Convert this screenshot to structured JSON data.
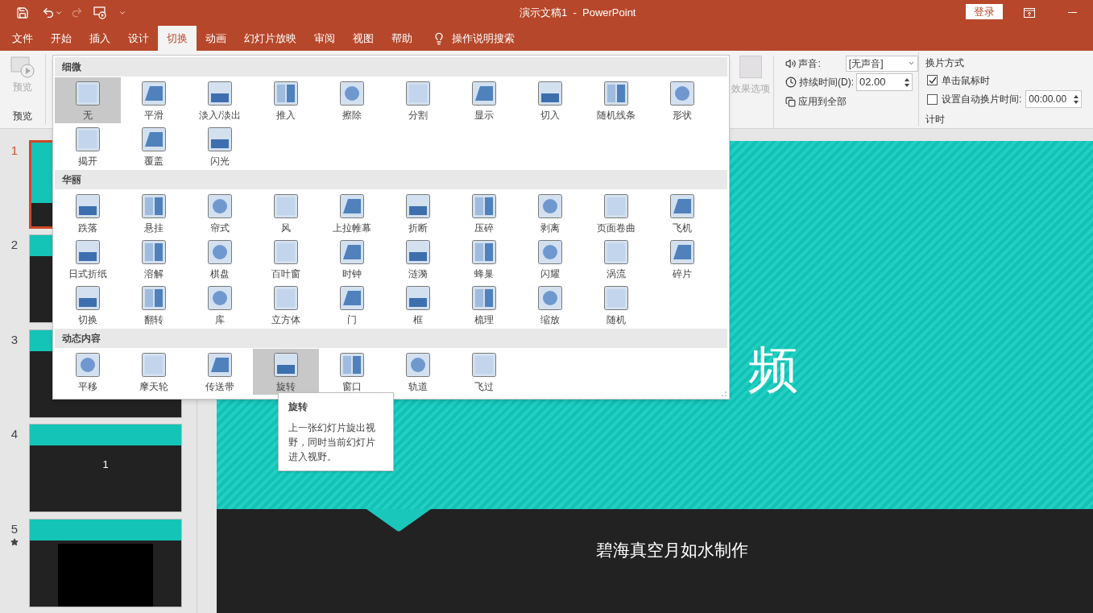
{
  "window": {
    "title": "演示文稿1  -  PowerPoint",
    "sign_in": "登录"
  },
  "tabs": [
    {
      "label": "文件",
      "selected": false
    },
    {
      "label": "开始",
      "selected": false
    },
    {
      "label": "插入",
      "selected": false
    },
    {
      "label": "设计",
      "selected": false
    },
    {
      "label": "切换",
      "selected": true
    },
    {
      "label": "动画",
      "selected": false
    },
    {
      "label": "幻灯片放映",
      "selected": false
    },
    {
      "label": "审阅",
      "selected": false
    },
    {
      "label": "视图",
      "selected": false
    },
    {
      "label": "帮助",
      "selected": false
    }
  ],
  "tell_me": "操作说明搜索",
  "preview": {
    "button": "预览",
    "group": "预览"
  },
  "effect_options": "效果选项",
  "timing": {
    "sound_label": "声音:",
    "sound_value": "[无声音]",
    "duration_label": "持续时间(D):",
    "duration_value": "02.00",
    "apply_all": "应用到全部",
    "advance_header": "换片方式",
    "on_click": {
      "label": "单击鼠标时",
      "checked": true
    },
    "after": {
      "label": "设置自动换片时间:",
      "checked": false,
      "value": "00:00.00"
    },
    "group": "计时"
  },
  "gallery": {
    "sections": [
      {
        "title": "细微",
        "items": [
          {
            "label": "无",
            "selected": true
          },
          {
            "label": "平滑",
            "selected": false
          },
          {
            "label": "淡入/淡出",
            "selected": false
          },
          {
            "label": "推入",
            "selected": false
          },
          {
            "label": "擦除",
            "selected": false
          },
          {
            "label": "分割",
            "selected": false
          },
          {
            "label": "显示",
            "selected": false
          },
          {
            "label": "切入",
            "selected": false
          },
          {
            "label": "随机线条",
            "selected": false
          },
          {
            "label": "形状",
            "selected": false
          },
          {
            "label": "揭开",
            "selected": false
          },
          {
            "label": "覆盖",
            "selected": false
          },
          {
            "label": "闪光",
            "selected": false
          }
        ]
      },
      {
        "title": "华丽",
        "items": [
          {
            "label": "跌落",
            "selected": false
          },
          {
            "label": "悬挂",
            "selected": false
          },
          {
            "label": "帘式",
            "selected": false
          },
          {
            "label": "风",
            "selected": false
          },
          {
            "label": "上拉帷幕",
            "selected": false
          },
          {
            "label": "折断",
            "selected": false
          },
          {
            "label": "压碎",
            "selected": false
          },
          {
            "label": "剥离",
            "selected": false
          },
          {
            "label": "页面卷曲",
            "selected": false
          },
          {
            "label": "飞机",
            "selected": false
          },
          {
            "label": "日式折纸",
            "selected": false
          },
          {
            "label": "溶解",
            "selected": false
          },
          {
            "label": "棋盘",
            "selected": false
          },
          {
            "label": "百叶窗",
            "selected": false
          },
          {
            "label": "时钟",
            "selected": false
          },
          {
            "label": "涟漪",
            "selected": false
          },
          {
            "label": "蜂巢",
            "selected": false
          },
          {
            "label": "闪耀",
            "selected": false
          },
          {
            "label": "涡流",
            "selected": false
          },
          {
            "label": "碎片",
            "selected": false
          },
          {
            "label": "切换",
            "selected": false
          },
          {
            "label": "翻转",
            "selected": false
          },
          {
            "label": "库",
            "selected": false
          },
          {
            "label": "立方体",
            "selected": false
          },
          {
            "label": "门",
            "selected": false
          },
          {
            "label": "框",
            "selected": false
          },
          {
            "label": "梳理",
            "selected": false
          },
          {
            "label": "缩放",
            "selected": false
          },
          {
            "label": "随机",
            "selected": false
          }
        ]
      },
      {
        "title": "动态内容",
        "items": [
          {
            "label": "平移",
            "selected": false
          },
          {
            "label": "摩天轮",
            "selected": false
          },
          {
            "label": "传送带",
            "selected": false
          },
          {
            "label": "旋转",
            "selected": true
          },
          {
            "label": "窗口",
            "selected": false
          },
          {
            "label": "轨道",
            "selected": false
          },
          {
            "label": "飞过",
            "selected": false
          }
        ]
      }
    ]
  },
  "tooltip": {
    "title": "旋转",
    "body": "上一张幻灯片旋出视野，同时当前幻灯片进入视野。"
  },
  "slides": [
    {
      "number": "1",
      "selected": true,
      "animated": false,
      "kind": "title"
    },
    {
      "number": "2",
      "selected": false,
      "animated": false,
      "kind": "content"
    },
    {
      "number": "3",
      "selected": false,
      "animated": false,
      "kind": "content"
    },
    {
      "number": "4",
      "selected": false,
      "animated": false,
      "kind": "content",
      "text": "1"
    },
    {
      "number": "5",
      "selected": false,
      "animated": true,
      "kind": "video"
    }
  ],
  "slide": {
    "title": "频",
    "subtitle": "碧海真空月如水制作"
  }
}
